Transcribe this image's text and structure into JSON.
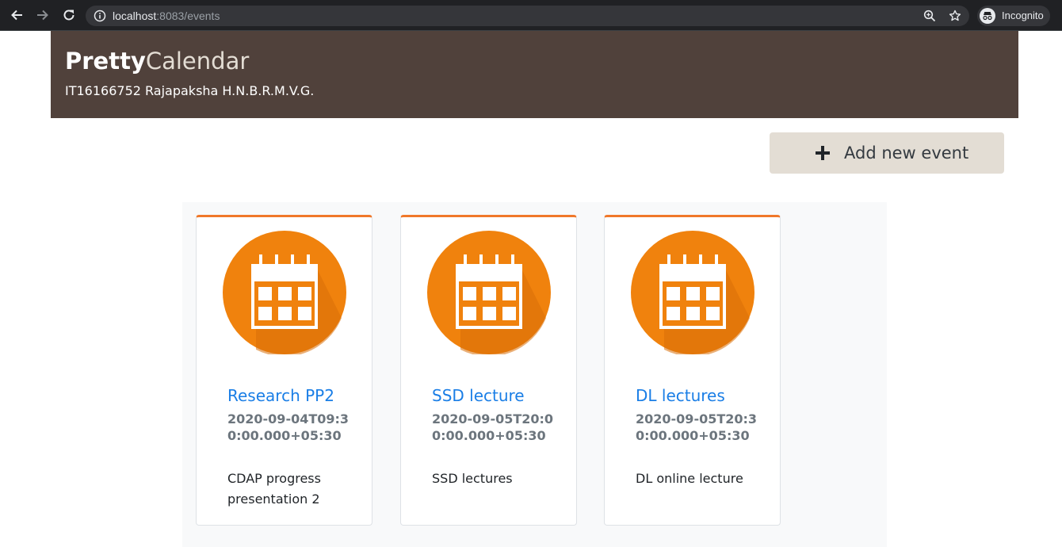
{
  "browser": {
    "url_host": "localhost",
    "url_path": ":8083/events",
    "profile_label": "Incognito"
  },
  "header": {
    "brand_bold": "Pretty",
    "brand_light": "Calendar",
    "subtitle": "IT16166752 Rajapaksha H.N.B.R.M.V.G."
  },
  "toolbar": {
    "add_label": "Add new event"
  },
  "events": [
    {
      "title": "Research PP2",
      "date": "2020-09-04T09:30:00.000+05:30",
      "description": "CDAP progress presentation 2"
    },
    {
      "title": "SSD lecture",
      "date": "2020-09-05T20:00:00.000+05:30",
      "description": "SSD lectures"
    },
    {
      "title": "DL lectures",
      "date": "2020-09-05T20:30:00.000+05:30",
      "description": "DL online lecture"
    }
  ],
  "colors": {
    "header_bg": "#50413b",
    "accent": "#f0782a",
    "link": "#1a7ee6",
    "button_bg": "#e3ddd4"
  },
  "icons": [
    "back-arrow-icon",
    "forward-arrow-icon",
    "reload-icon",
    "info-icon",
    "zoom-icon",
    "star-icon",
    "incognito-icon",
    "plus-icon",
    "calendar-icon"
  ]
}
